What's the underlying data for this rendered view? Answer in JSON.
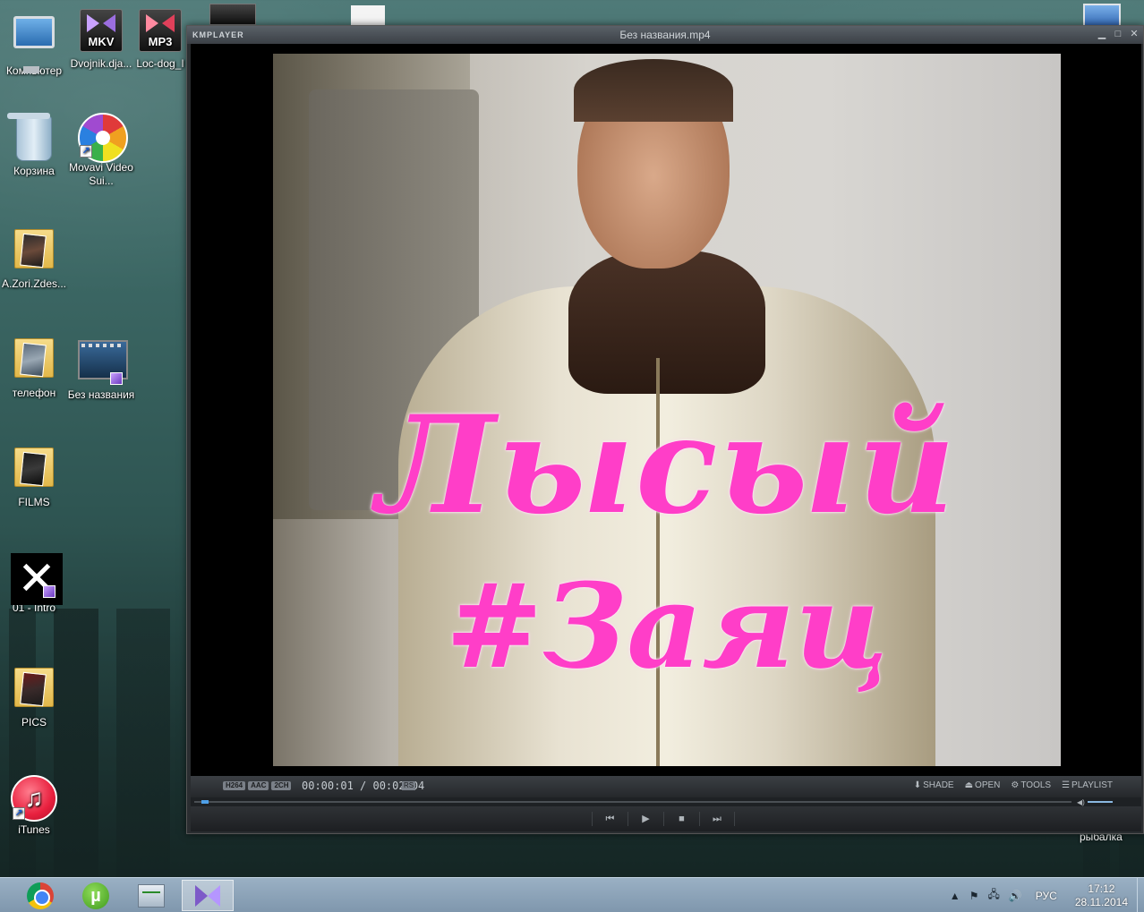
{
  "desktop": {
    "icons": [
      {
        "label": "Компьютер"
      },
      {
        "label": "Dvojnik.dja..."
      },
      {
        "label": "Loc-dog_I"
      },
      {
        "label": "Корзина"
      },
      {
        "label": "Movavi Video Sui..."
      },
      {
        "label": "A.Zori.Zdes..."
      },
      {
        "label": "телефон"
      },
      {
        "label": "Без названия"
      },
      {
        "label": "FILMS"
      },
      {
        "label": "01 - Intro"
      },
      {
        "label": "PICS"
      },
      {
        "label": "iTunes"
      }
    ],
    "badges": {
      "mkv": "MKV",
      "mp3": "MP3"
    },
    "right_label": "рыбалка"
  },
  "player": {
    "logo": "KMPLAYER",
    "window_title": "Без названия.mp4",
    "overlay_line1": "Лысый",
    "overlay_line2": "#Заяц",
    "codec_badges": [
      "H264",
      "AAC",
      "2CH"
    ],
    "time_current": "00:00:01",
    "time_total": "00:02:04",
    "rs_label": "RS",
    "buttons": {
      "shade": "SHADE",
      "open": "OPEN",
      "tools": "TOOLS",
      "playlist": "PLAYLIST"
    },
    "progress": 0.008
  },
  "taskbar": {
    "language": "РУС",
    "time": "17:12",
    "date": "28.11.2014"
  }
}
